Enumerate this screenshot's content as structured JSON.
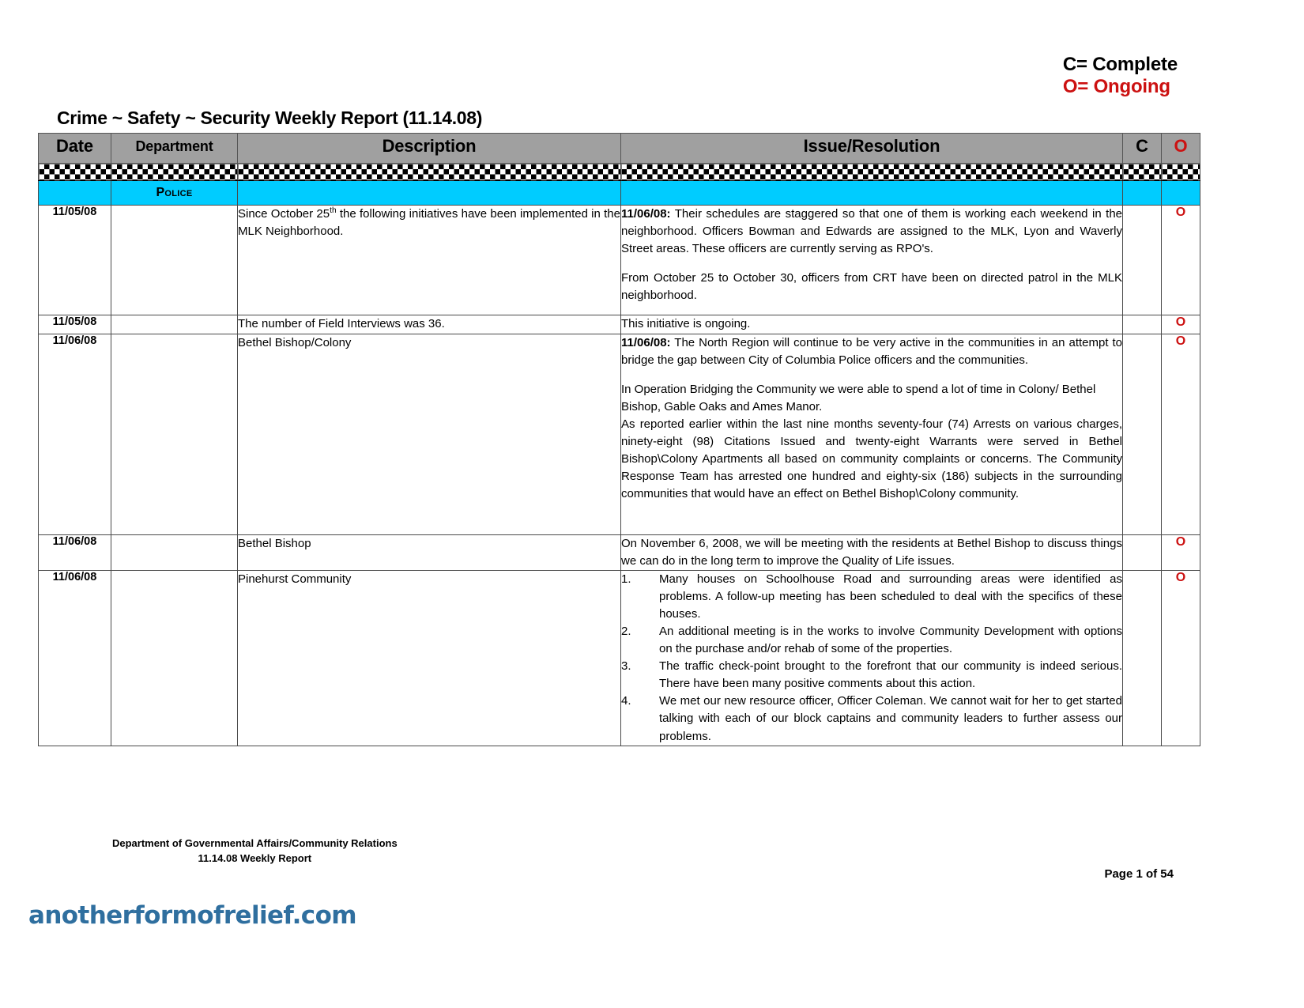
{
  "legend": {
    "complete": "C= Complete",
    "ongoing": "O= Ongoing"
  },
  "title": "Crime ~ Safety ~ Security Weekly Report (11.14.08)",
  "table": {
    "headers": {
      "date": "Date",
      "department": "Department",
      "description": "Description",
      "issue": "Issue/Resolution",
      "c": "C",
      "o": "O"
    },
    "section": {
      "label": "Police"
    },
    "rows": [
      {
        "date": "11/05/08",
        "department": "",
        "description_pre": "Since October 25",
        "description_sup": "th",
        "description_post": " the following initiatives have been implemented in the MLK Neighborhood.",
        "issue_bold": "11/06/08:",
        "issue_p1": "  Their schedules are staggered so that one of them is working each weekend in the neighborhood.   Officers Bowman and Edwards are assigned to the MLK, Lyon and Waverly Street areas.  These officers are currently serving as RPO's.",
        "issue_p2": "From October 25 to October 30, officers from CRT have been on directed patrol in the MLK neighborhood.",
        "c": "",
        "o": "O"
      },
      {
        "date": "11/05/08",
        "department": "",
        "description": "The number of Field Interviews was 36.",
        "issue": "This initiative is ongoing.",
        "c": "",
        "o": "O"
      },
      {
        "date": "11/06/08",
        "department": "",
        "description": "Bethel Bishop/Colony",
        "issue_bold": "11/06/08:",
        "issue_p1": "  The North Region will continue to be very active in the communities in an attempt to bridge the gap between City of Columbia Police officers and the communities.",
        "issue_p2": "In Operation Bridging the Community we were able to spend a lot of time in Colony/ Bethel Bishop, Gable Oaks and Ames Manor.",
        "issue_p3": "As reported earlier within the last nine months seventy-four (74) Arrests on various charges, ninety-eight (98) Citations Issued and twenty-eight Warrants were served in Bethel Bishop\\Colony Apartments all based on community complaints or concerns. The Community Response Team has arrested one hundred and eighty-six (186) subjects in the surrounding communities that would have an effect on Bethel Bishop\\Colony community.",
        "c": "",
        "o": "O"
      },
      {
        "date": "11/06/08",
        "department": "",
        "description": "Bethel Bishop",
        "issue": "On November 6, 2008, we will be meeting with the residents at Bethel Bishop to discuss things we can do in the long term to improve the Quality of Life issues.",
        "c": "",
        "o": "O"
      },
      {
        "date": "11/06/08",
        "department": "",
        "description": "Pinehurst Community",
        "issue_list": [
          "Many houses on Schoolhouse Road and surrounding areas were identified as problems.  A follow-up meeting has been scheduled to deal with the specifics of these houses.",
          "An additional meeting is in the works to involve Community Development with options on the purchase and/or rehab of some of the properties.",
          "The traffic check-point brought to the forefront that our community is indeed serious.  There have been many positive comments about this action.",
          "We met our new resource officer, Officer Coleman.  We cannot wait for her to get started talking with each of our block captains and community leaders to further assess our problems."
        ],
        "c": "",
        "o": "O"
      }
    ]
  },
  "footer": {
    "line1": "Department of Governmental Affairs/Community Relations",
    "line2": "11.14.08 Weekly Report",
    "page": "Page 1 of 54"
  },
  "watermark": "anotherformofrelief.com",
  "colors": {
    "ongoing_red": "#cc1111",
    "section_band": "#00ccff",
    "header_gray": "#a0a0a0",
    "watermark_blue": "#2f6f9f"
  }
}
